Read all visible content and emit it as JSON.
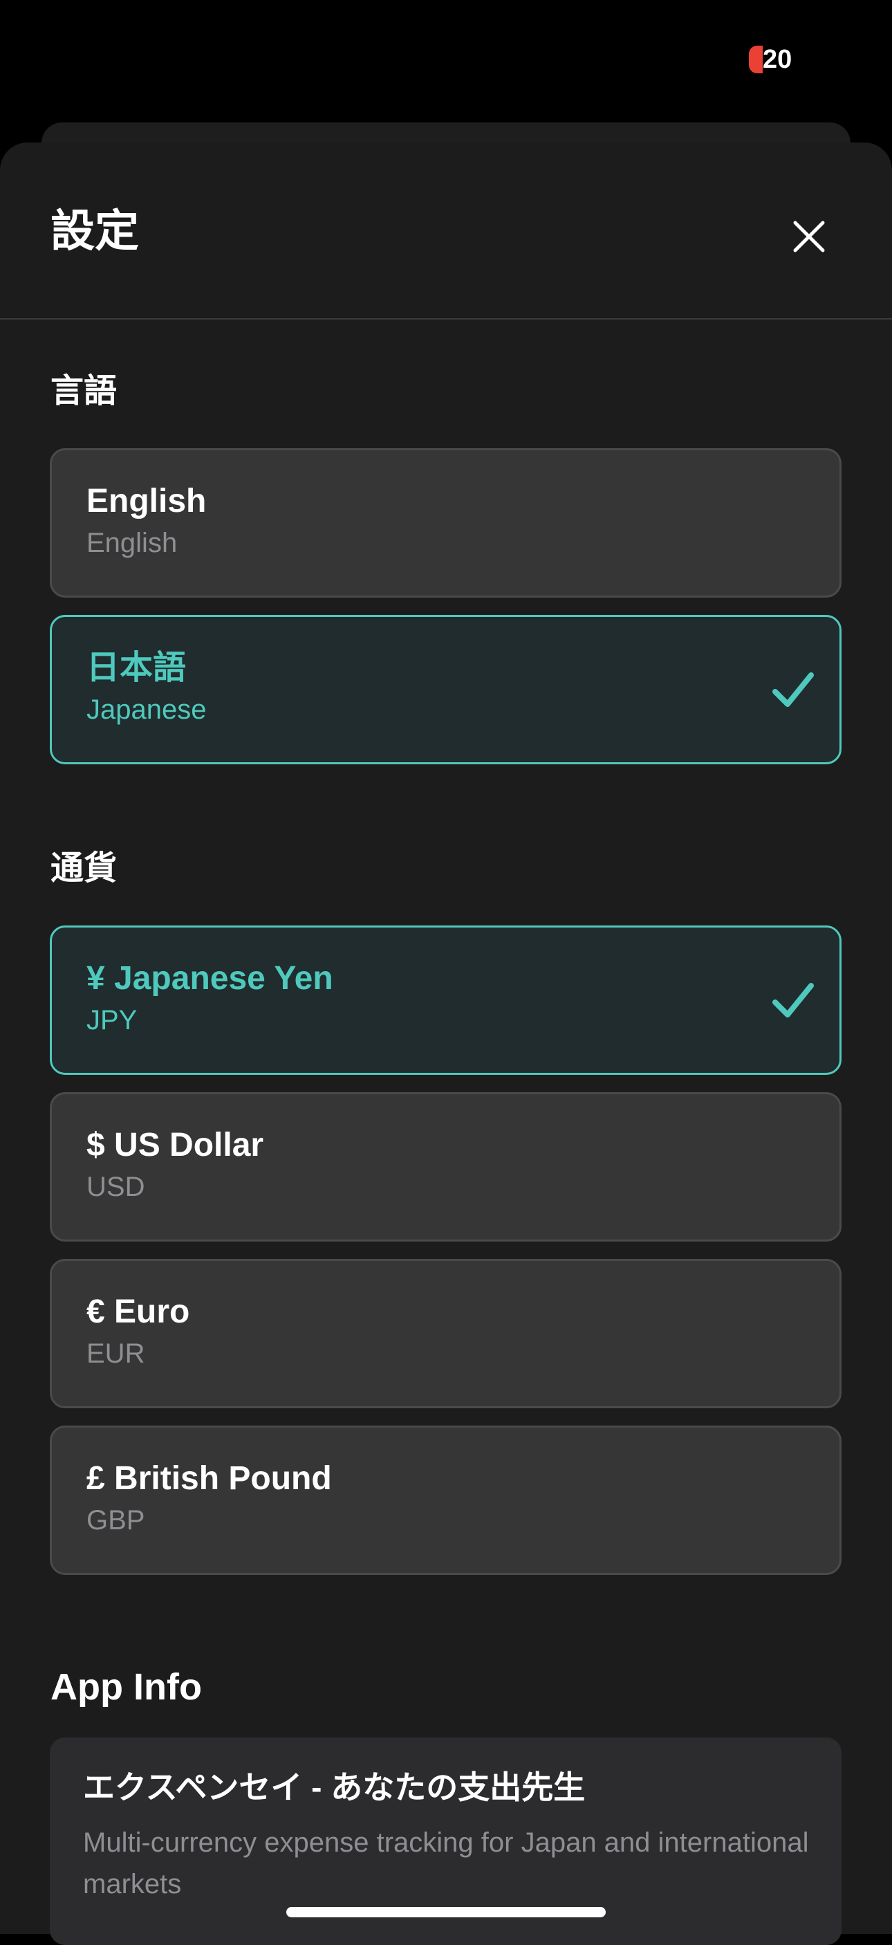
{
  "status": {
    "battery": "20",
    "battery_color": "#eb4034"
  },
  "sheet": {
    "title": "設定"
  },
  "language": {
    "title": "言語",
    "options": [
      {
        "label": "English",
        "sub": "English",
        "selected": false
      },
      {
        "label": "日本語",
        "sub": "Japanese",
        "selected": true
      }
    ]
  },
  "currency": {
    "title": "通貨",
    "options": [
      {
        "label": "¥ Japanese Yen",
        "sub": "JPY",
        "selected": true
      },
      {
        "label": "$ US Dollar",
        "sub": "USD",
        "selected": false
      },
      {
        "label": "€ Euro",
        "sub": "EUR",
        "selected": false
      },
      {
        "label": "£ British Pound",
        "sub": "GBP",
        "selected": false
      }
    ]
  },
  "app_info": {
    "title": "App Info",
    "name": "エクスペンセイ - あなたの支出先生",
    "description": "Multi-currency expense tracking for Japan and international markets"
  },
  "colors": {
    "accent": "#4fc9bd",
    "background": "#1c1c1d",
    "card": "#363637"
  }
}
